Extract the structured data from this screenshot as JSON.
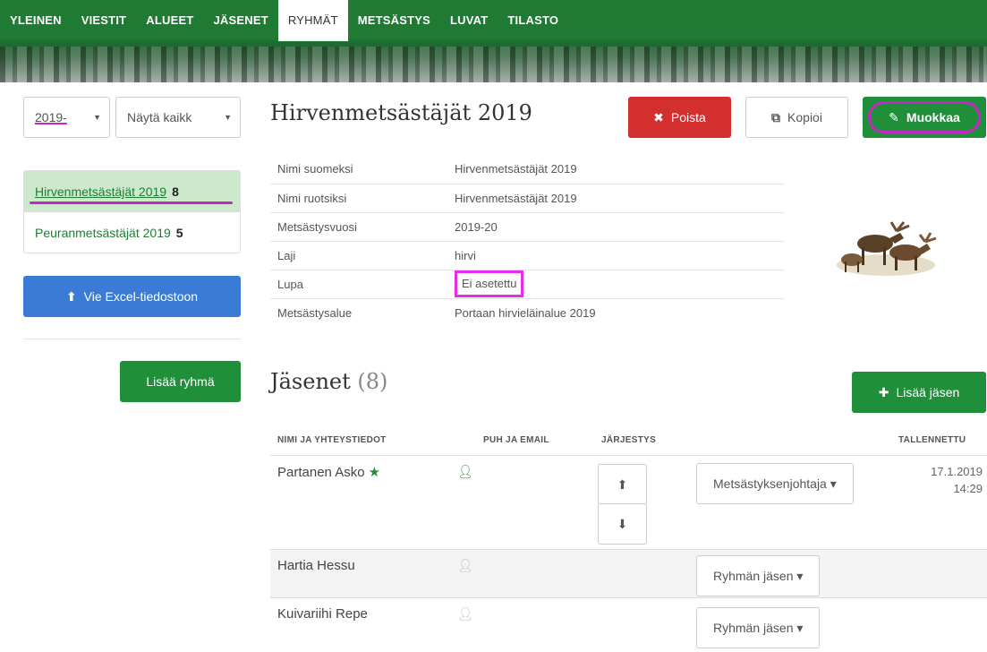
{
  "nav": {
    "items": [
      {
        "label": "YLEINEN",
        "active": false
      },
      {
        "label": "VIESTIT",
        "active": false
      },
      {
        "label": "ALUEET",
        "active": false
      },
      {
        "label": "JÄSENET",
        "active": false
      },
      {
        "label": "RYHMÄT",
        "active": true
      },
      {
        "label": "METSÄSTYS",
        "active": false
      },
      {
        "label": "LUVAT",
        "active": false
      },
      {
        "label": "TILASTO",
        "active": false
      }
    ]
  },
  "sidebar": {
    "year_select": {
      "value": "2019-"
    },
    "filter_select": {
      "value": "Näytä kaikk"
    },
    "groups": [
      {
        "name": "Hirvenmetsästäjät 2019",
        "count": "8",
        "active": true
      },
      {
        "name": "Peuranmetsästäjät 2019",
        "count": "5",
        "active": false
      }
    ],
    "excel_button": "Vie Excel-tiedostoon",
    "add_group_button": "Lisää ryhmä"
  },
  "group": {
    "title": "Hirvenmetsästäjät 2019",
    "actions": {
      "delete": "Poista",
      "copy": "Kopioi",
      "edit": "Muokkaa"
    },
    "details": [
      {
        "key": "Nimi suomeksi",
        "value": "Hirvenmetsästäjät 2019"
      },
      {
        "key": "Nimi ruotsiksi",
        "value": "Hirvenmetsästäjät 2019"
      },
      {
        "key": "Metsästysvuosi",
        "value": "2019-20"
      },
      {
        "key": "Laji",
        "value": "hirvi"
      },
      {
        "key": "Lupa",
        "value": "Ei asetettu"
      },
      {
        "key": "Metsästysalue",
        "value": "Portaan hirvieläinalue 2019"
      }
    ]
  },
  "members": {
    "title": "Jäsenet",
    "count": "(8)",
    "add_button": "Lisää jäsen",
    "columns": {
      "name": "NIMI JA YHTEYSTIEDOT",
      "contact": "PUH JA EMAIL",
      "order": "JÄRJESTYS",
      "saved": "TALLENNETTU"
    },
    "rows": [
      {
        "name": "Partanen Asko",
        "leader": true,
        "contact_active": true,
        "role": "Metsästyksenjohtaja",
        "saved_date": "17.1.2019",
        "saved_time": "14:29"
      },
      {
        "name": "Hartia Hessu",
        "leader": false,
        "contact_active": false,
        "role": "Ryhmän jäsen",
        "saved_date": "",
        "saved_time": ""
      },
      {
        "name": "Kuivariihi Repe",
        "leader": false,
        "contact_active": false,
        "role": "Ryhmän jäsen",
        "saved_date": "",
        "saved_time": ""
      }
    ]
  },
  "colors": {
    "primary_green": "#1f8f3a",
    "danger_red": "#d32f2f",
    "info_blue": "#3a7bd5",
    "highlight_magenta": "#c427c4"
  }
}
